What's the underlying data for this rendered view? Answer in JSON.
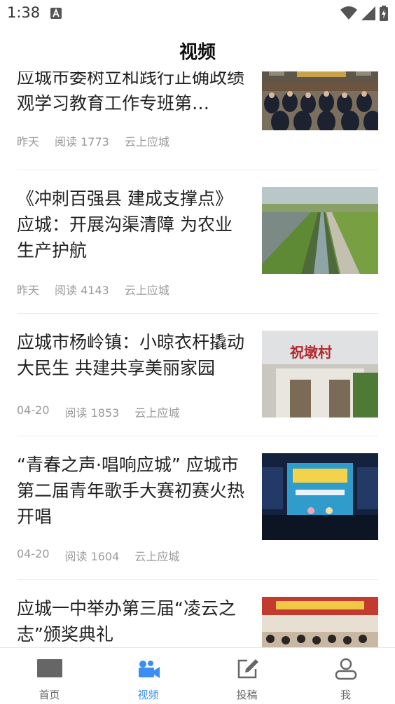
{
  "status_bar": {
    "time": "1:38"
  },
  "header": {
    "title": "视频"
  },
  "articles": [
    {
      "title": "应城市委树立和践行正确政绩观学习教育工作专班第…",
      "date": "昨天",
      "reads": "阅读 1773",
      "source": "云上应城"
    },
    {
      "title": "《冲刺百强县 建成支撑点》应城：开展沟渠清障 为农业生产护航",
      "date": "昨天",
      "reads": "阅读 4143",
      "source": "云上应城"
    },
    {
      "title": "应城市杨岭镇：小晾衣杆撬动大民生 共建共享美丽家园",
      "date": "04-20",
      "reads": "阅读 1853",
      "source": "云上应城",
      "thumb_sign": "祝墩村"
    },
    {
      "title": "“青春之声·唱响应城” 应城市第二届青年歌手大赛初赛火热开唱",
      "date": "04-20",
      "reads": "阅读 1604",
      "source": "云上应城"
    },
    {
      "title": "应城一中举办第三届“凌云之志”颁奖典礼"
    }
  ],
  "tabbar": {
    "items": [
      {
        "label": "首页",
        "icon": "home-icon"
      },
      {
        "label": "视频",
        "icon": "video-icon",
        "active": true
      },
      {
        "label": "投稿",
        "icon": "edit-icon"
      },
      {
        "label": "我",
        "icon": "user-icon"
      }
    ]
  },
  "colors": {
    "accent": "#3b8ef3",
    "text": "#222222",
    "meta": "#9a9a9a"
  }
}
